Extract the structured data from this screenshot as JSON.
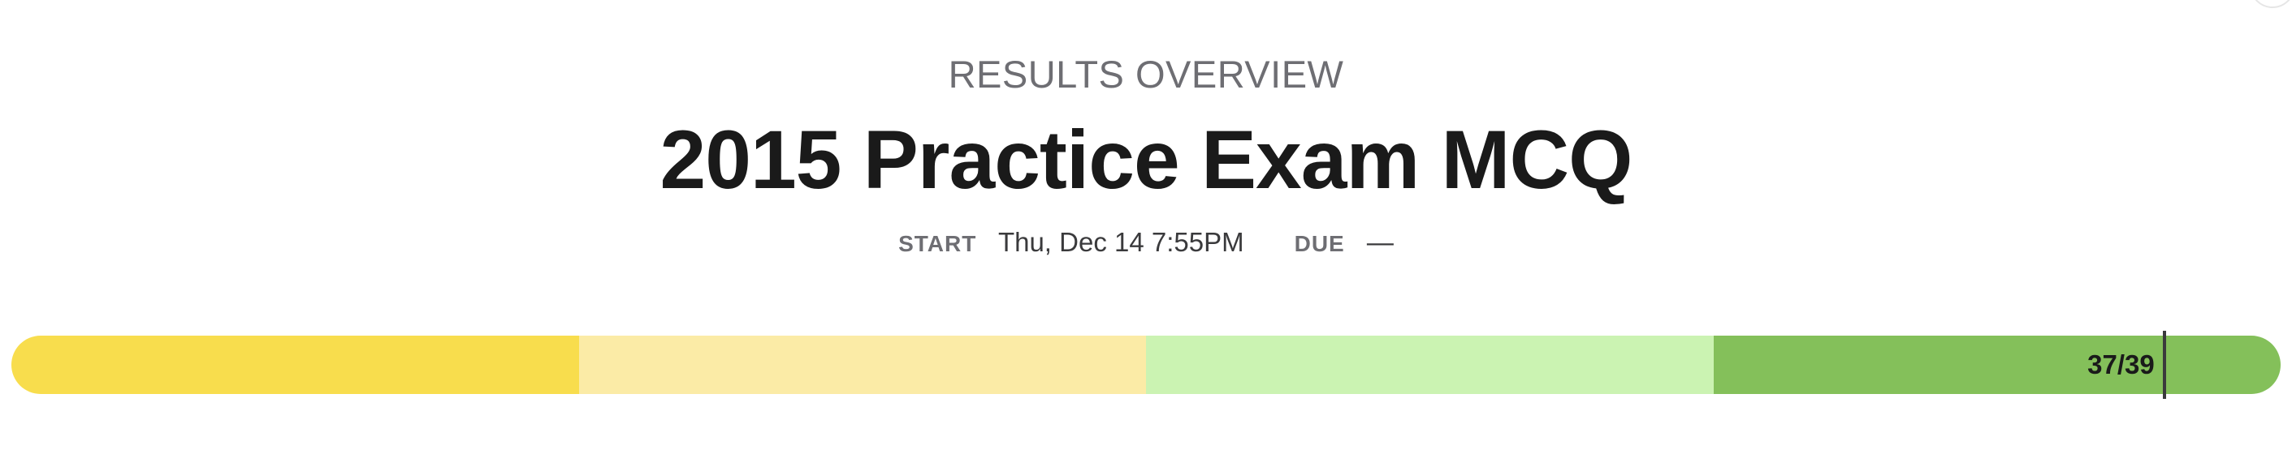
{
  "header": {
    "eyebrow": "RESULTS OVERVIEW",
    "title": "2015 Practice Exam MCQ"
  },
  "meta": {
    "start_label": "START",
    "start_value": "Thu, Dec 14 7:55PM",
    "due_label": "DUE",
    "due_value": "—"
  },
  "score": {
    "label": "37/39",
    "correct": 37,
    "total": 39
  },
  "progress_segments": [
    {
      "name": "band-1",
      "color": "#f8dd4d",
      "fraction": 0.25
    },
    {
      "name": "band-2",
      "color": "#fbeba6",
      "fraction": 0.25
    },
    {
      "name": "band-3",
      "color": "#cbf3b2",
      "fraction": 0.25
    },
    {
      "name": "band-4",
      "color": "#84c05a",
      "fraction": 0.25
    }
  ]
}
